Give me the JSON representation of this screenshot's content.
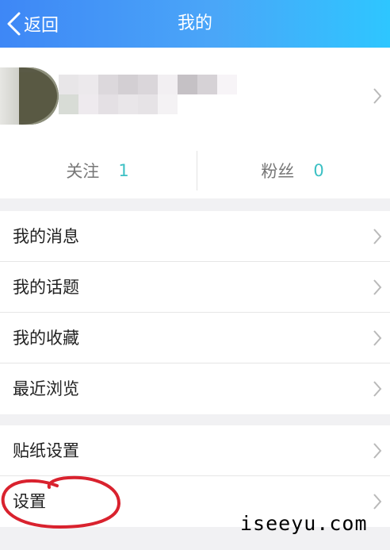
{
  "header": {
    "back_label": "返回",
    "title": "我的",
    "gradient_start": "#3e87f6",
    "gradient_end": "#2ec6ff"
  },
  "profile": {
    "avatar": "avatar-blurred",
    "username_obscured": true,
    "stats": [
      {
        "label": "关注",
        "value": "1"
      },
      {
        "label": "粉丝",
        "value": "0"
      }
    ],
    "stat_value_color": "#3cc0c4"
  },
  "menu_group_1": [
    {
      "label": "我的消息"
    },
    {
      "label": "我的话题"
    },
    {
      "label": "我的收藏"
    },
    {
      "label": "最近浏览"
    }
  ],
  "menu_group_2": [
    {
      "label": "贴纸设置"
    },
    {
      "label": "设置"
    }
  ],
  "annotation": {
    "circle_color": "#d9222e",
    "circled_item": "设置"
  },
  "watermark": "iseeyu.com"
}
